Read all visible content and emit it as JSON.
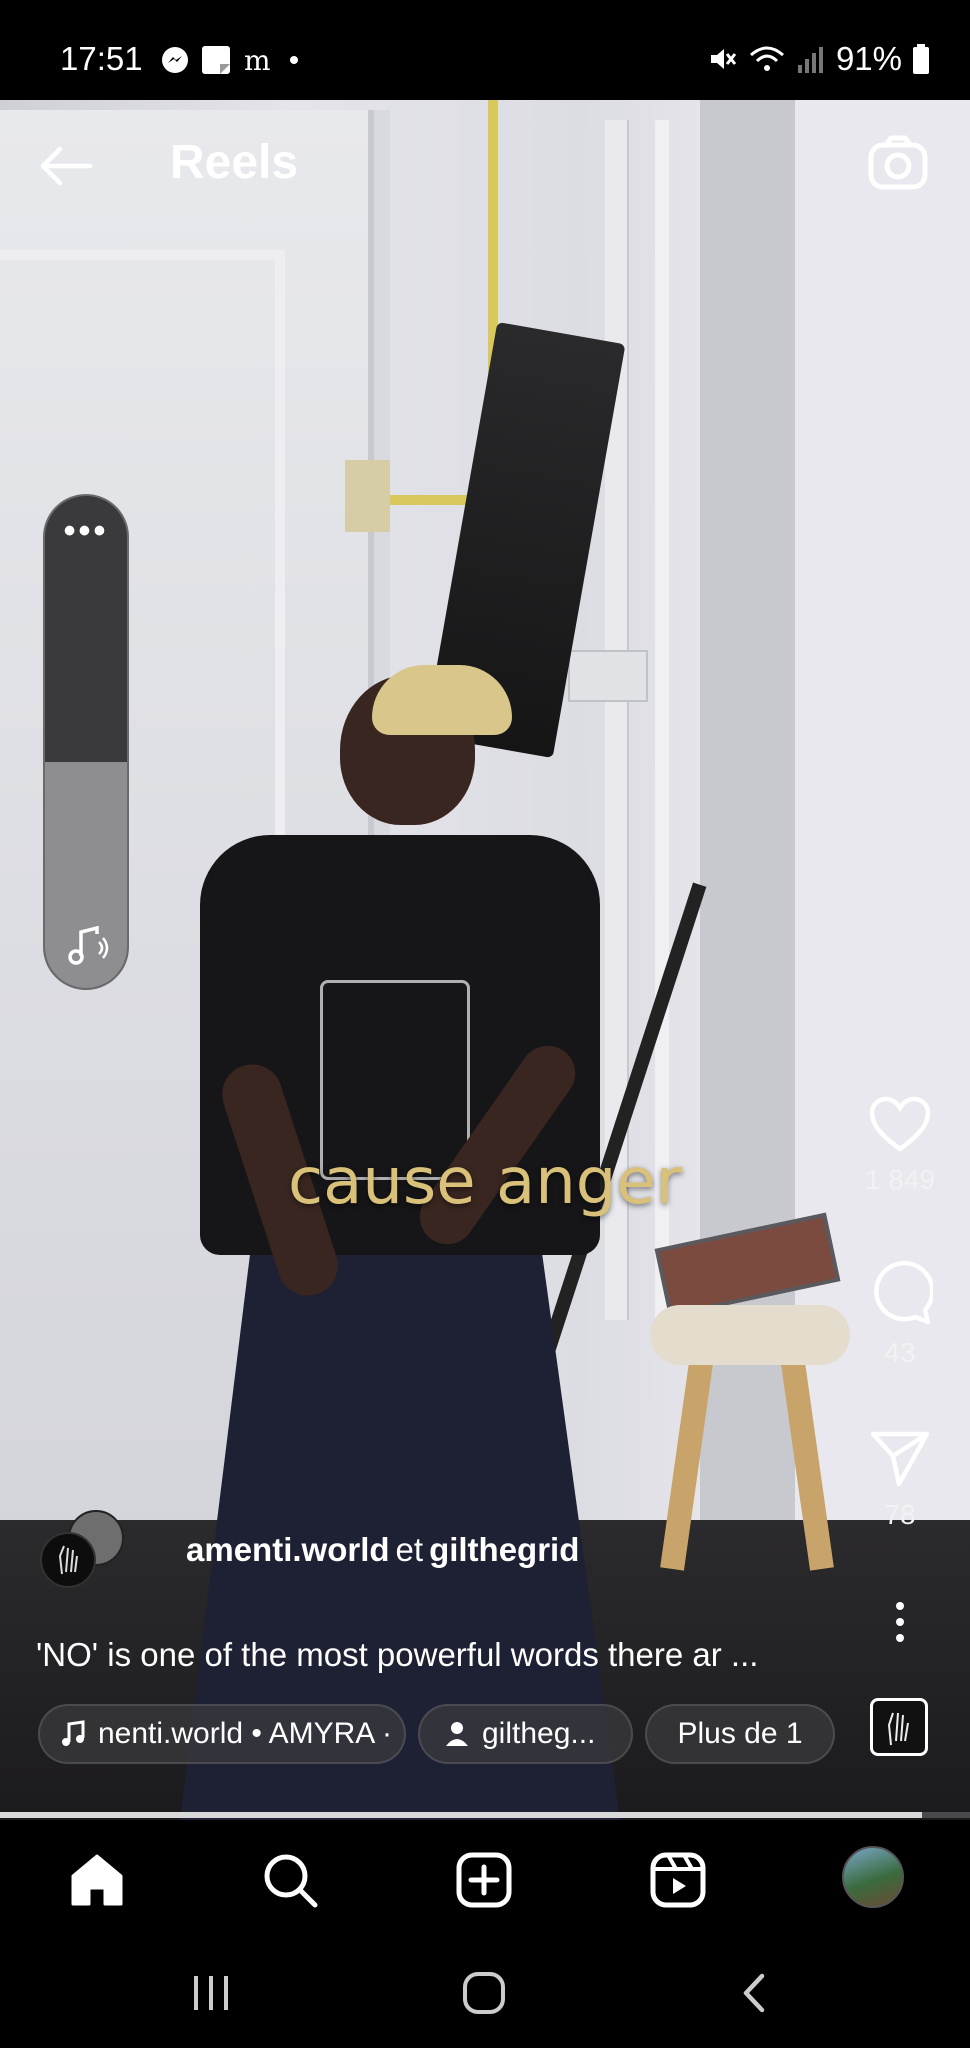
{
  "status_bar": {
    "time": "17:51",
    "battery": "91%",
    "left_icons": [
      "messenger-icon",
      "notes-icon",
      "news-icon",
      "dot-icon"
    ],
    "right_icons": [
      "mute-icon",
      "wifi-icon",
      "signal-icon",
      "battery-icon"
    ]
  },
  "header": {
    "title": "Reels"
  },
  "video": {
    "caption_overlay": "cause anger"
  },
  "volume": {
    "level": 0.46,
    "more_label": "•••"
  },
  "actions": {
    "likes": "1 849",
    "comments": "43",
    "shares": "78"
  },
  "post": {
    "author_primary": "amenti.world",
    "conjunction": "et",
    "author_secondary": "gilthegrid",
    "description": "'NO' is one of the most powerful words there ar ..."
  },
  "chips": {
    "music": "nenti.world • AMYRA ·",
    "tagged_user": "giltheg...",
    "more": "Plus de 1"
  },
  "progress": {
    "value": 0.95
  },
  "colors": {
    "caption": "#d9c17a",
    "background": "#000000",
    "text": "#ffffff"
  }
}
